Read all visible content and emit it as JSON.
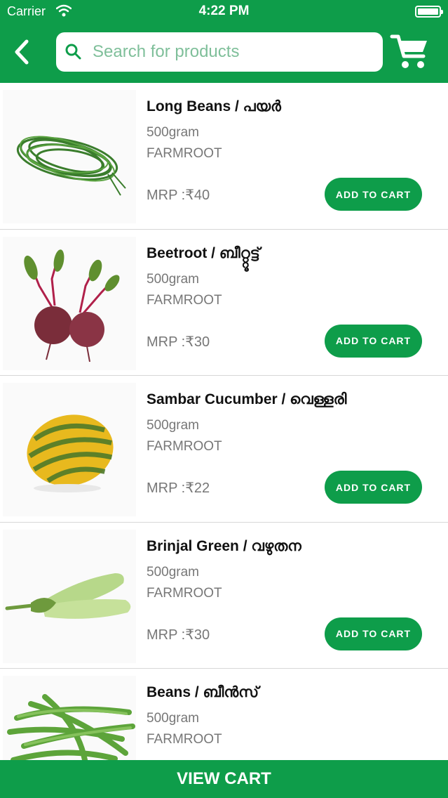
{
  "status_bar": {
    "carrier": "Carrier",
    "time": "4:22 PM"
  },
  "header": {
    "search_placeholder": "Search for products"
  },
  "icons": {
    "back": "chevron-left-icon",
    "search": "search-icon",
    "cart": "shopping-cart-icon",
    "wifi": "wifi-icon",
    "battery": "battery-icon"
  },
  "colors": {
    "brand": "#0e9d4a",
    "placeholder": "#7fbf9a",
    "muted_text": "#777777"
  },
  "products": [
    {
      "name": "Long Beans /  പയർ",
      "quantity": "500gram",
      "brand": "FARMROOT",
      "price": "MRP :₹40",
      "button": "ADD TO CART",
      "image": "long-beans"
    },
    {
      "name": "Beetroot /  ബീറ്റ്റൂട്ട്",
      "quantity": "500gram",
      "brand": "FARMROOT",
      "price": "MRP :₹30",
      "button": "ADD TO CART",
      "image": "beetroot"
    },
    {
      "name": "Sambar Cucumber /  വെള്ളരി",
      "quantity": "500gram",
      "brand": "FARMROOT",
      "price": "MRP :₹22",
      "button": "ADD TO CART",
      "image": "sambar-cucumber"
    },
    {
      "name": "Brinjal Green /  വഴുതന",
      "quantity": "500gram",
      "brand": "FARMROOT",
      "price": "MRP :₹30",
      "button": "ADD TO CART",
      "image": "brinjal-green"
    },
    {
      "name": "Beans /  ബീൻസ്",
      "quantity": "500gram",
      "brand": "FARMROOT",
      "price": "",
      "button": "",
      "image": "beans"
    }
  ],
  "footer": {
    "view_cart": "VIEW CART"
  }
}
